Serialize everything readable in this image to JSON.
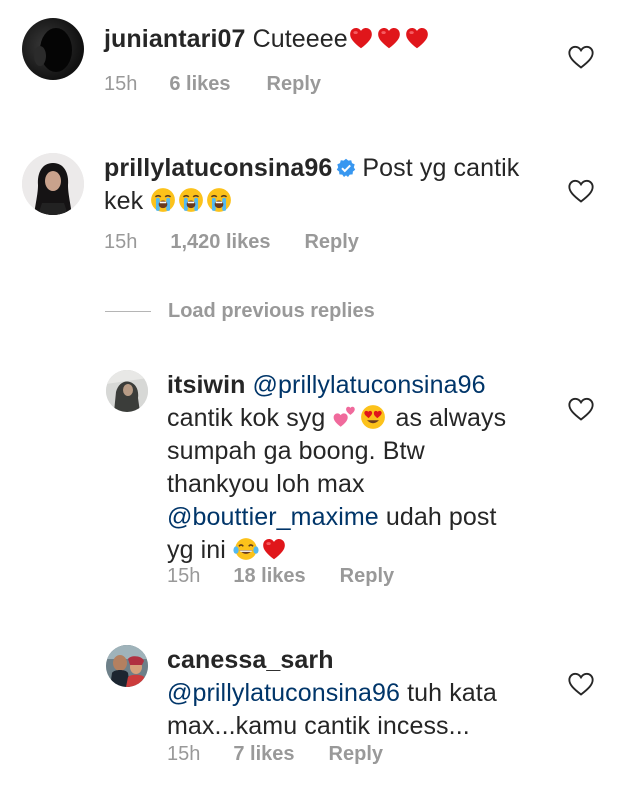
{
  "comments": [
    {
      "username": "juniantari07",
      "text": "Cuteeee",
      "emoji": [
        "red-heart",
        "red-heart",
        "red-heart"
      ],
      "time": "15h",
      "likes": "6 likes",
      "reply": "Reply"
    },
    {
      "username": "prillylatuconsina96",
      "verified": true,
      "text_line1": "Post yg cantik",
      "text_line2": "kek",
      "emoji": [
        "loudly-crying-face",
        "loudly-crying-face",
        "loudly-crying-face"
      ],
      "time": "15h",
      "likes": "1,420 likes",
      "reply": "Reply"
    }
  ],
  "load_previous": "Load previous replies",
  "replies": [
    {
      "username": "itsiwin",
      "mention": "@prillylatuconsina96",
      "line1": "cantik kok syg",
      "line1_after": "as always",
      "line2": "sumpah ga boong. Btw",
      "line3": "thankyou loh max",
      "mention2": "@bouttier_maxime",
      "line4_after": "udah post",
      "line5": "yg ini",
      "emoji": [
        "two-hearts",
        "heart-eyes-face",
        "tears-of-joy-face",
        "red-heart"
      ],
      "time": "15h",
      "likes": "18 likes",
      "reply": "Reply"
    },
    {
      "username": "canessa_sarh",
      "mention": "@prillylatuconsina96",
      "line1_after": "tuh kata",
      "line2": "max...kamu cantik incess...",
      "time": "15h",
      "likes": "7 likes",
      "reply": "Reply"
    }
  ],
  "colors": {
    "text": "#262626",
    "meta": "#999999",
    "mention": "#003569",
    "verified": "#3897f0",
    "heart_emoji": "#e0161b"
  }
}
